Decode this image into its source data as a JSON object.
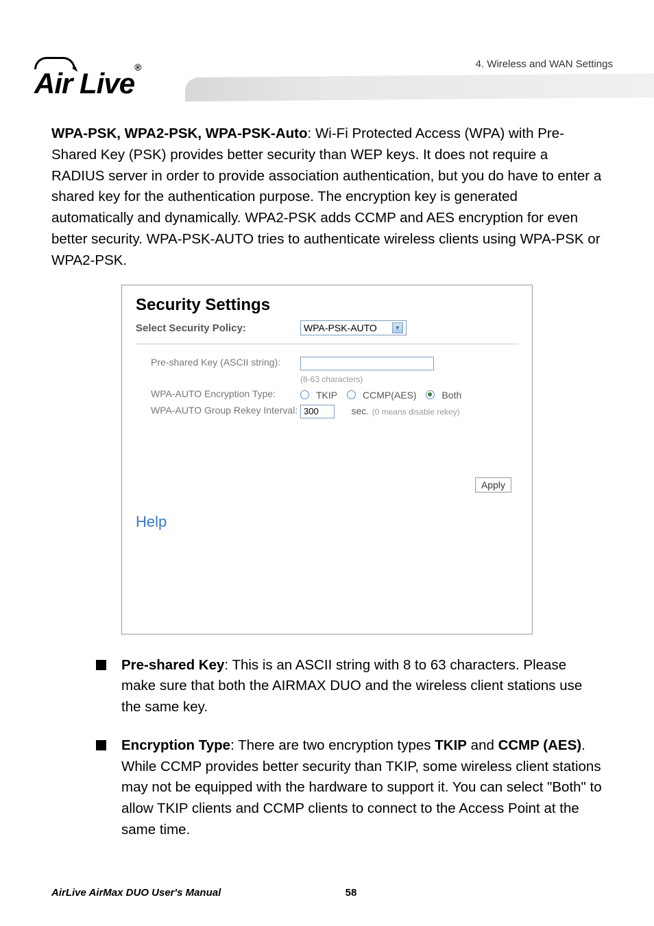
{
  "header": {
    "chapter": "4. Wireless and WAN Settings",
    "logo_text": "Air Live",
    "logo_reg": "®"
  },
  "intro": {
    "bold": "WPA-PSK, WPA2-PSK, WPA-PSK-Auto",
    "text": ": Wi-Fi Protected Access (WPA) with Pre-Shared Key (PSK) provides better security than WEP keys. It does not require a RADIUS server in order to provide association authentication, but you do have to enter a shared key for the authentication purpose. The encryption key is generated automatically and dynamically. WPA2-PSK adds CCMP and AES encryption for even better security. WPA-PSK-AUTO tries to authenticate wireless clients using WPA-PSK or WPA2-PSK."
  },
  "screenshot": {
    "title": "Security Settings",
    "policy_label": "Select Security Policy:",
    "policy_value": "WPA-PSK-AUTO",
    "psk_label": "Pre-shared Key (ASCII string):",
    "psk_value": "",
    "psk_hint": "(8-63 characters)",
    "enc_label": "WPA-AUTO Encryption Type:",
    "enc_options": {
      "tkip": "TKIP",
      "ccmp": "CCMP(AES)",
      "both": "Both"
    },
    "enc_selected": "both",
    "rekey_label": "WPA-AUTO Group Rekey Interval:",
    "rekey_value": "300",
    "rekey_unit": "sec.",
    "rekey_hint": "(0 means disable rekey)",
    "apply": "Apply",
    "help": "Help"
  },
  "bullets": {
    "b1_bold": "Pre-shared Key",
    "b1_text": ": This is an ASCII string with 8 to 63 characters. Please make sure that both the AIRMAX DUO and the wireless client stations use the same key.",
    "b2_bold": "Encryption Type",
    "b2_mid": ": There are two encryption types ",
    "b2_bold2": "TKIP",
    "b2_and": " and ",
    "b2_bold3": "CCMP (AES)",
    "b2_text": ". While CCMP provides better security than TKIP, some wireless client stations may not be equipped with the hardware to support it. You can select \"Both\" to allow TKIP clients and CCMP clients to connect to the Access Point at the same time."
  },
  "footer": {
    "manual": "AirLive AirMax DUO User's Manual",
    "page": "58"
  }
}
